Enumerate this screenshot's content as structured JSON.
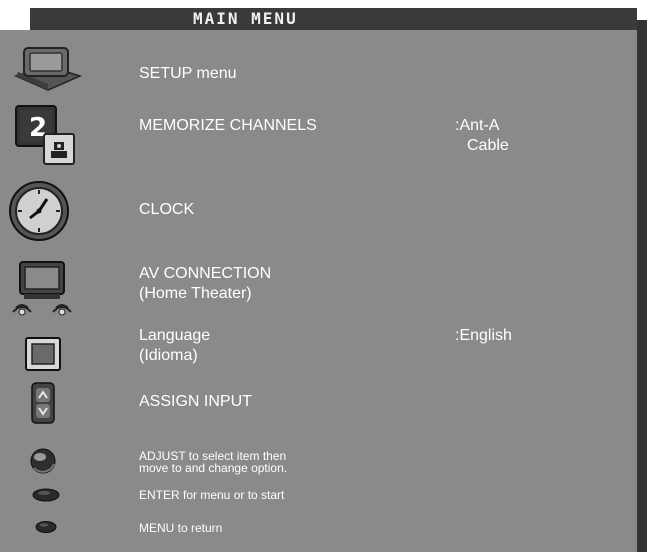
{
  "menu": {
    "title": "MAIN MENU"
  },
  "items": [
    {
      "label": "SETUP menu",
      "icon": "setup-monitor-icon"
    },
    {
      "label": "MEMORIZE CHANNELS",
      "value_line1": ":Ant-A",
      "value_line2": "Cable",
      "icon": "channel-memory-icon"
    },
    {
      "label": "CLOCK",
      "icon": "clock-icon"
    },
    {
      "label": "AV CONNECTION",
      "sublabel": "(Home Theater)",
      "icon": "av-speakers-icon"
    },
    {
      "label": "Language",
      "sublabel": "(Idioma)",
      "value_line1": ":English",
      "icon": "language-square-icon"
    },
    {
      "label": "ASSIGN INPUT",
      "icon": "up-down-icon"
    }
  ],
  "hints": {
    "adjust_line1": "ADJUST to select item then",
    "adjust_line2": "move to and change option.",
    "enter": "ENTER for menu or to start",
    "menu": "MENU to return"
  },
  "colors": {
    "panel": "#8a8a8a",
    "titlebar": "#3a3a3a",
    "text": "#ffffff"
  }
}
